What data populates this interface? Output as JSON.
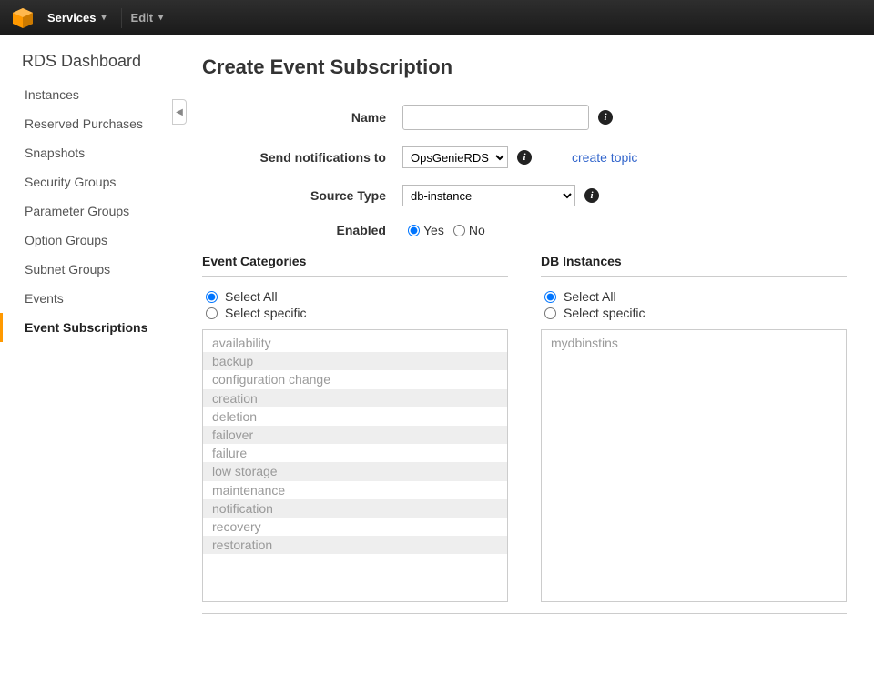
{
  "topnav": {
    "services_label": "Services",
    "edit_label": "Edit"
  },
  "sidebar": {
    "title": "RDS Dashboard",
    "items": [
      {
        "label": "Instances",
        "active": false
      },
      {
        "label": "Reserved Purchases",
        "active": false
      },
      {
        "label": "Snapshots",
        "active": false
      },
      {
        "label": "Security Groups",
        "active": false
      },
      {
        "label": "Parameter Groups",
        "active": false
      },
      {
        "label": "Option Groups",
        "active": false
      },
      {
        "label": "Subnet Groups",
        "active": false
      },
      {
        "label": "Events",
        "active": false
      },
      {
        "label": "Event Subscriptions",
        "active": true
      }
    ]
  },
  "page": {
    "title": "Create Event Subscription"
  },
  "form": {
    "name_label": "Name",
    "name_value": "",
    "notify_label": "Send notifications to",
    "notify_selected": "OpsGenieRDS",
    "create_topic_label": "create topic",
    "source_type_label": "Source Type",
    "source_type_selected": "db-instance",
    "enabled_label": "Enabled",
    "enabled_yes": "Yes",
    "enabled_no": "No",
    "enabled_value": "yes"
  },
  "event_categories": {
    "title": "Event Categories",
    "select_all_label": "Select All",
    "select_specific_label": "Select specific",
    "mode": "all",
    "items": [
      "availability",
      "backup",
      "configuration change",
      "creation",
      "deletion",
      "failover",
      "failure",
      "low storage",
      "maintenance",
      "notification",
      "recovery",
      "restoration"
    ]
  },
  "db_instances": {
    "title": "DB Instances",
    "select_all_label": "Select All",
    "select_specific_label": "Select specific",
    "mode": "all",
    "items": [
      "mydbinstins"
    ]
  }
}
